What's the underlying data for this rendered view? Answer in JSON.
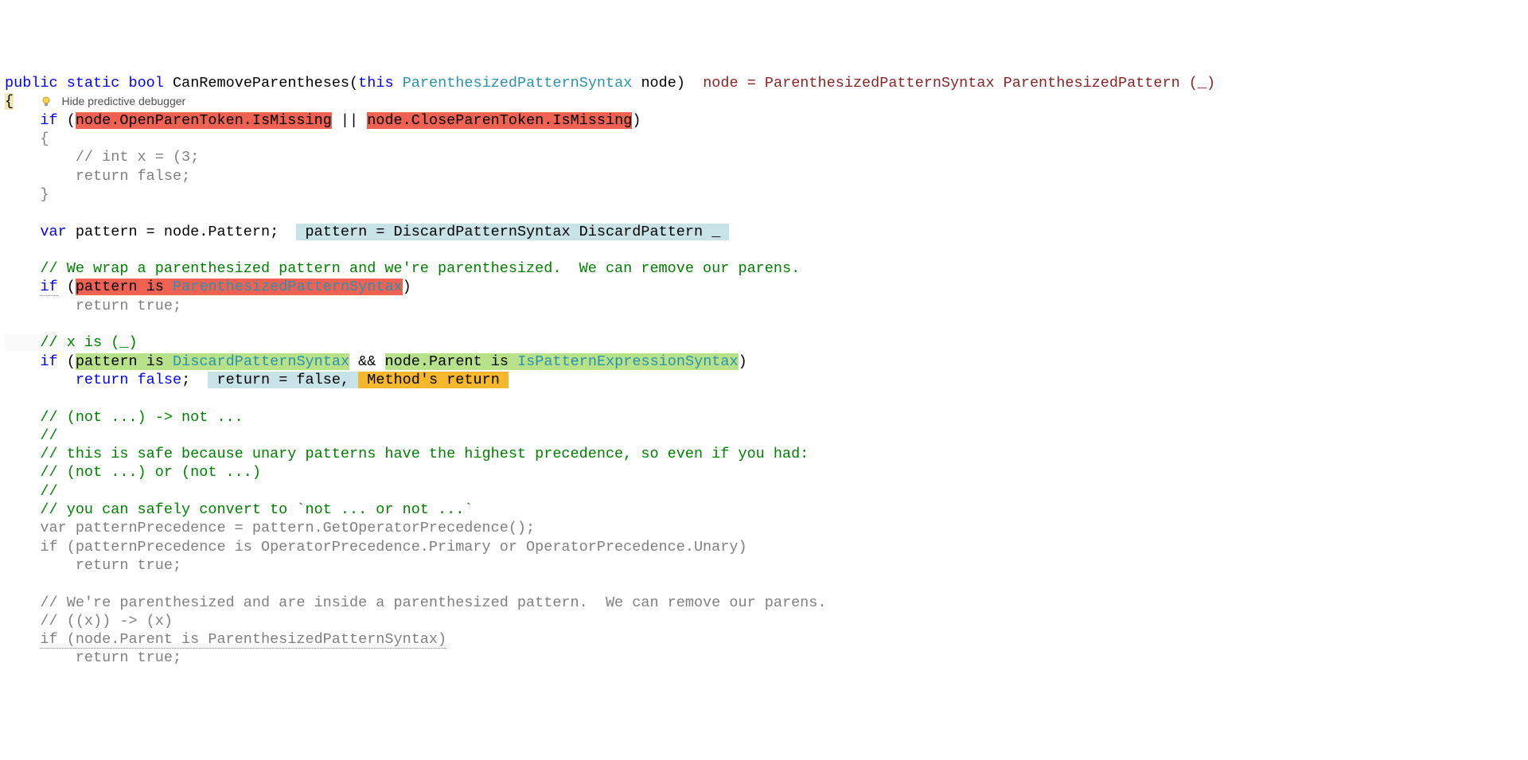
{
  "line1": {
    "public": "public",
    "static": "static",
    "bool": "bool",
    "method": "CanRemoveParentheses",
    "this": "this",
    "paramType": "ParenthesizedPatternSyntax",
    "paramName": "node",
    "debugInfo": "node = ParenthesizedPatternSyntax ParenthesizedPattern (_)"
  },
  "line2": {
    "brace": "{",
    "hideDebugger": "Hide predictive debugger"
  },
  "line3": {
    "if": "if",
    "cond1": "node.OpenParenToken.IsMissing",
    "or": "||",
    "cond2": "node.CloseParenToken.IsMissing"
  },
  "line4": {
    "brace": "{"
  },
  "line5": {
    "comment": "// int x = (3;"
  },
  "line6": {
    "return": "return",
    "false": "false"
  },
  "line7": {
    "brace": "}"
  },
  "line9": {
    "var": "var",
    "pattern": "pattern = node.Pattern;",
    "debugInfo": "pattern = DiscardPatternSyntax DiscardPattern _"
  },
  "line11": {
    "comment": "// We wrap a parenthesized pattern and we're parenthesized.  We can remove our parens."
  },
  "line12": {
    "if": "if",
    "cond": "pattern ",
    "is": "is",
    "type": "ParenthesizedPatternSyntax"
  },
  "line13": {
    "return": "return true;"
  },
  "line15": {
    "comment": "// x is (_)"
  },
  "line16": {
    "if": "if",
    "cond1": "pattern ",
    "is1": "is",
    "type1": "DiscardPatternSyntax",
    "and": "&&",
    "cond2": "node.Parent ",
    "is2": "is",
    "type2": "IsPatternExpressionSyntax"
  },
  "line17": {
    "return": "return",
    "false": "false",
    "semi": ";",
    "debug1": "return = false,",
    "debug2": "Method's return"
  },
  "line19": {
    "comment": "// (not ...) -> not ..."
  },
  "line20": {
    "comment": "//"
  },
  "line21": {
    "comment": "// this is safe because unary patterns have the highest precedence, so even if you had:"
  },
  "line22": {
    "comment": "// (not ...) or (not ...)"
  },
  "line23": {
    "comment": "//"
  },
  "line24": {
    "comment": "// you can safely convert to `not ... or not ...`"
  },
  "line25": {
    "code": "var patternPrecedence = pattern.GetOperatorPrecedence();"
  },
  "line26": {
    "code": "if (patternPrecedence is OperatorPrecedence.Primary or OperatorPrecedence.Unary)"
  },
  "line27": {
    "code": "    return true;"
  },
  "line29": {
    "comment": "// We're parenthesized and are inside a parenthesized pattern.  We can remove our parens."
  },
  "line30": {
    "comment": "// ((x)) -> (x)"
  },
  "line31": {
    "code": "if (node.Parent is ParenthesizedPatternSyntax)"
  },
  "line32": {
    "code": "    return true;"
  }
}
